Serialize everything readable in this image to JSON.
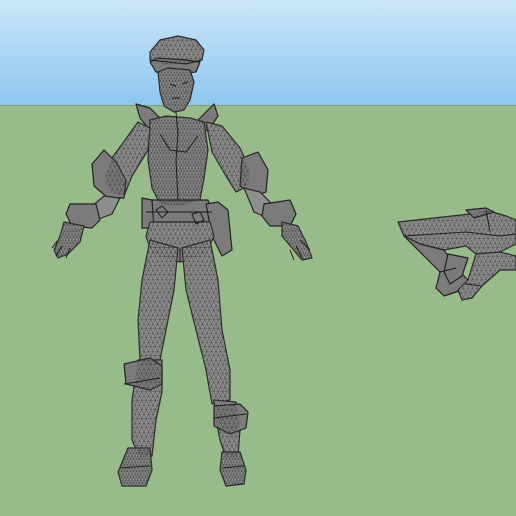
{
  "viewport": {
    "sky_color": "#a9d5f4",
    "ground_color": "#98bb8a"
  },
  "models": [
    {
      "icon": "character-mesh-icon"
    },
    {
      "icon": "crossbow-mesh-icon"
    }
  ]
}
